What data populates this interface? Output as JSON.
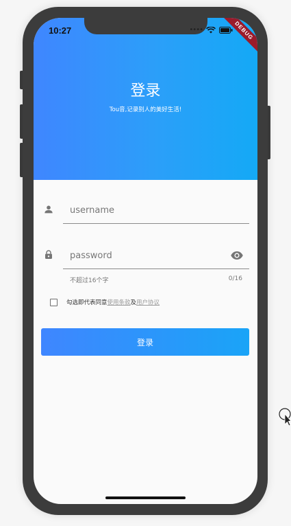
{
  "status_bar": {
    "time": "10:27",
    "debug_banner": "DEBUG"
  },
  "header": {
    "title": "登录",
    "subtitle": "Tou音,记录别人的美好生活!"
  },
  "form": {
    "username_placeholder": "username",
    "password_placeholder": "password",
    "password_hint": "不超过16个字",
    "password_counter": "0/16",
    "agree_prefix": "勾选即代表同意",
    "terms_link": "使用条款",
    "agree_conjunction": "及",
    "user_agreement_link": "用户协议",
    "checkbox_checked": false
  },
  "actions": {
    "login_label": "登录"
  },
  "icons": {
    "username_icon": "person-icon",
    "password_icon": "lock-icon",
    "visibility_icon": "eye-icon",
    "cursor_icon": "mouse-cursor-icon"
  },
  "colors": {
    "gradient_start": "#3f86ff",
    "gradient_end": "#14a9f6",
    "debug_banner": "#9b1b2b"
  }
}
